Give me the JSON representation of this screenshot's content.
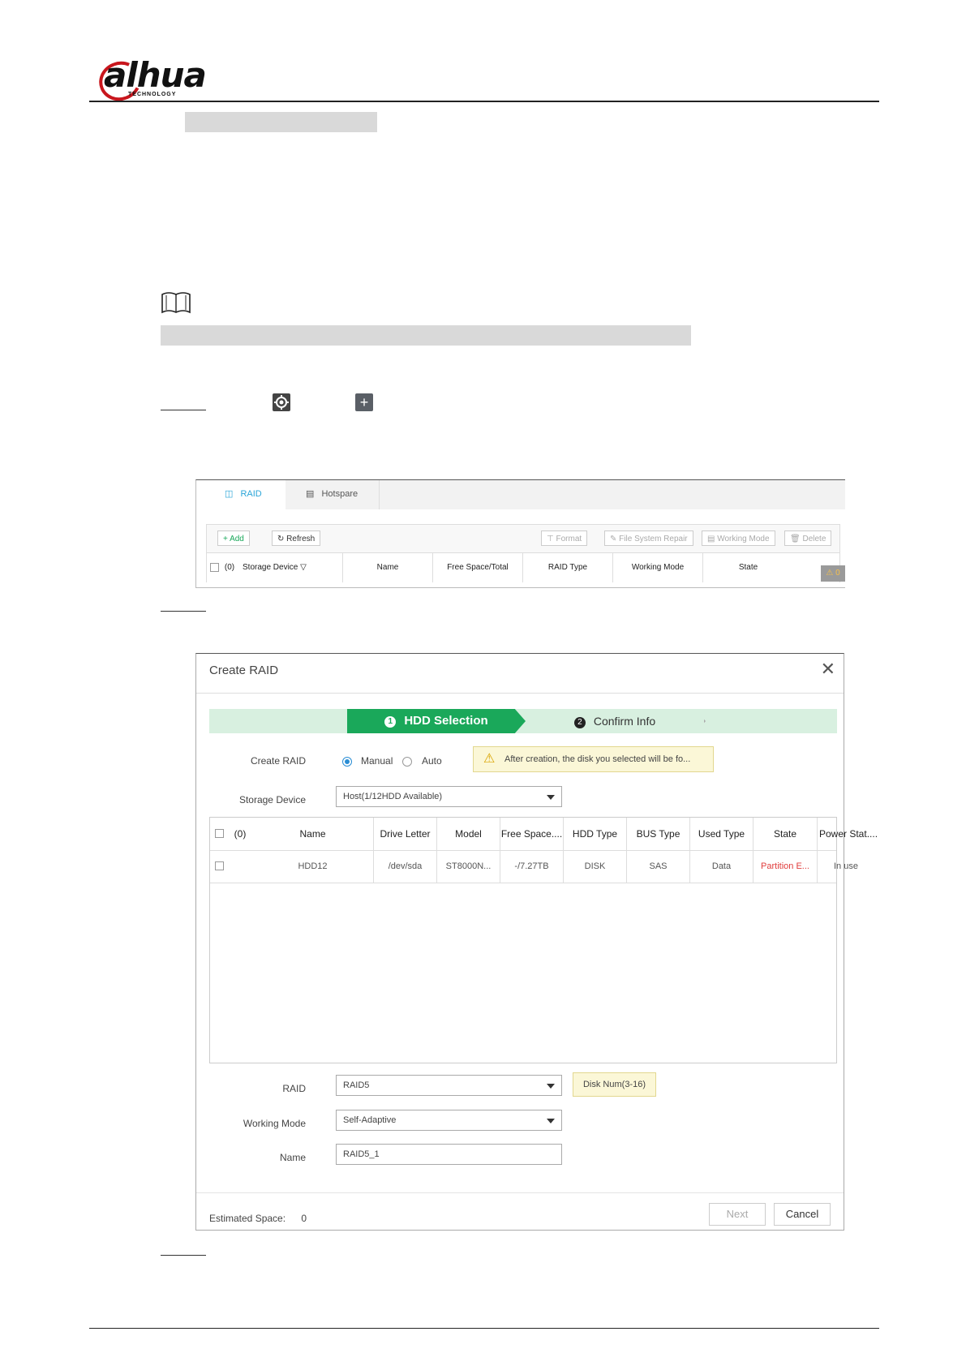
{
  "header": {
    "logo_text": "alhua",
    "logo_sub": "TECHNOLOGY"
  },
  "figure1": {
    "tabs": [
      "RAID",
      "Hotspare"
    ],
    "toolbar": {
      "add": "Add",
      "refresh": "Refresh",
      "format": "Format",
      "fs_repair": "File System Repair",
      "working_mode": "Working Mode",
      "delete": "Delete"
    },
    "columns": [
      "(0)",
      "Storage Device",
      "Name",
      "Free Space/Total",
      "RAID Type",
      "Working Mode",
      "State"
    ],
    "warn_count": "0"
  },
  "dialog": {
    "title": "Create RAID",
    "steps": [
      {
        "num": "1",
        "label": "HDD Selection"
      },
      {
        "num": "2",
        "label": "Confirm Info"
      }
    ],
    "create_raid_label": "Create RAID",
    "mode_options": [
      "Manual",
      "Auto"
    ],
    "mode_selected": "Manual",
    "tip": "After creation, the disk you selected will be fo...",
    "storage_device_label": "Storage Device",
    "storage_device_value": "Host(1/12HDD Available)",
    "table": {
      "headers": [
        "(0)",
        "Name",
        "Drive Letter",
        "Model",
        "Free Space....",
        "HDD Type",
        "BUS Type",
        "Used Type",
        "State",
        "Power Stat...."
      ],
      "rows": [
        {
          "name": "HDD12",
          "drive": "/dev/sda",
          "model": "ST8000N...",
          "free": "-/7.27TB",
          "hdd_type": "DISK",
          "bus": "SAS",
          "used": "Data",
          "state": "Partition E...",
          "power": "In use"
        }
      ]
    },
    "raid_label": "RAID",
    "raid_value": "RAID5",
    "disk_num_tip": "Disk Num(3-16)",
    "working_mode_label": "Working Mode",
    "working_mode_value": "Self-Adaptive",
    "name_label": "Name",
    "name_value": "RAID5_1",
    "estimated_label": "Estimated Space:",
    "estimated_value": "0",
    "next_label": "Next",
    "cancel_label": "Cancel"
  },
  "colors": {
    "accent_blue": "#2aa5d8",
    "wizard_green": "#1aa85a",
    "wizard_bg": "#d8f0e0",
    "error_red": "#e03c3c",
    "logo_red": "#c8161d"
  }
}
